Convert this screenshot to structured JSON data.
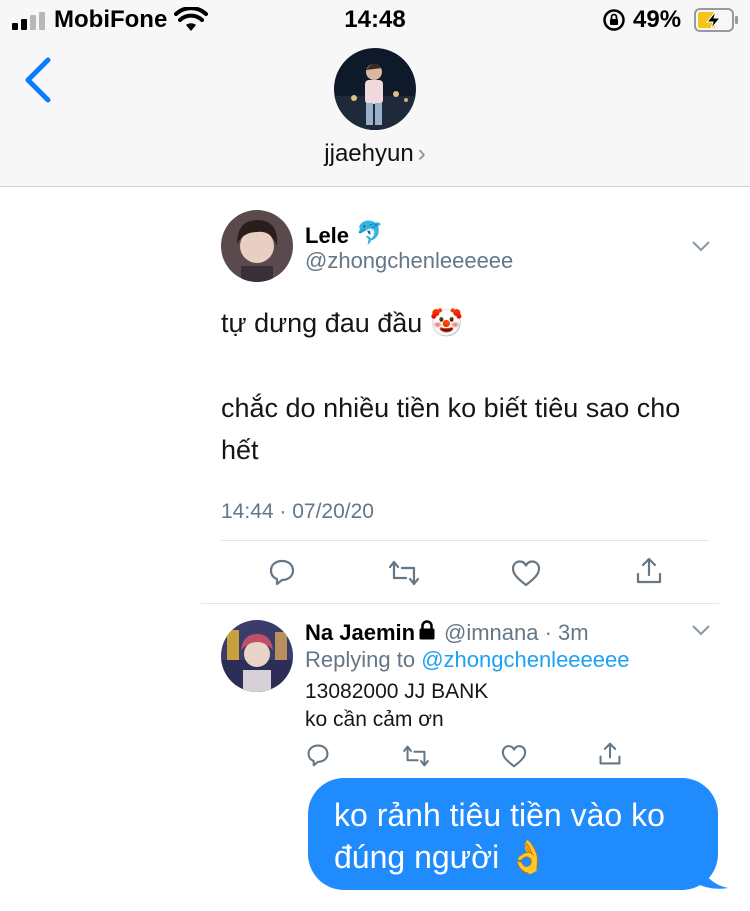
{
  "status_bar": {
    "carrier": "MobiFone",
    "time": "14:48",
    "battery": "49%"
  },
  "header": {
    "contact_name": "jjaehyun",
    "chevron": "›"
  },
  "tweet": {
    "name": "Lele",
    "name_emoji": "🐬",
    "handle": "@zhongchenleeeeee",
    "line1": "tự dưng đau đầu",
    "line1_emoji": "🤡",
    "line2": "chắc do nhiều tiền ko biết tiêu sao cho",
    "line3": "hết",
    "timestamp": "14:44 · 07/20/20"
  },
  "reply": {
    "name": "Na Jaemin",
    "handle_time": "@imnana · 3m",
    "replying_prefix": "Replying to",
    "replying_handle": "@zhongchenleeeeee",
    "line1": "13082000 JJ BANK",
    "line2": "ko cần cảm ơn"
  },
  "message": {
    "text": "ko rảnh tiêu tiền vào ko đúng người",
    "emoji": "👌"
  },
  "colors": {
    "bubble": "#1f8bfd",
    "link": "#1da1f2",
    "back": "#0a7aff"
  }
}
